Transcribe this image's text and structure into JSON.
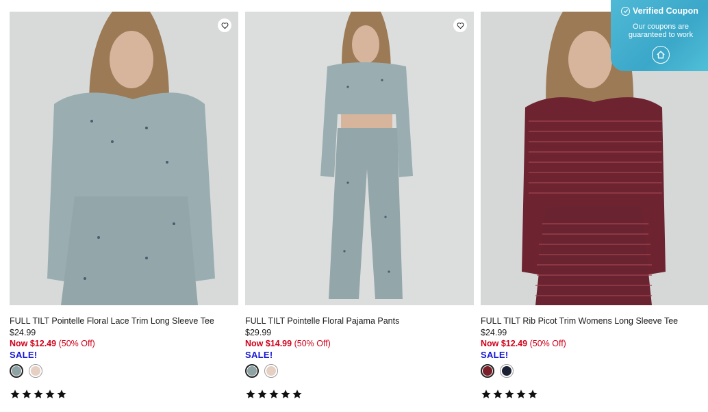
{
  "products": [
    {
      "name": "FULL TILT Pointelle Floral Lace Trim Long Sleeve Tee",
      "price": "$24.99",
      "sale_price": "Now $12.49",
      "discount": "(50% Off)",
      "sale_label": "SALE!",
      "swatches": [
        "#8fa3a5",
        "#e6cfc3"
      ],
      "rating": 5
    },
    {
      "name": "FULL TILT Pointelle Floral Pajama Pants",
      "price": "$29.99",
      "sale_price": "Now $14.99",
      "discount": "(50% Off)",
      "sale_label": "SALE!",
      "swatches": [
        "#8fa3a5",
        "#e6cfc3"
      ],
      "rating": 5
    },
    {
      "name": "FULL TILT Rib Picot Trim Womens Long Sleeve Tee",
      "price": "$24.99",
      "sale_price": "Now $12.49",
      "discount": "(50% Off)",
      "sale_label": "SALE!",
      "swatches": [
        "#7a1f2a",
        "#1c2233"
      ],
      "rating": 5
    }
  ],
  "coupon": {
    "title": "Verified Coupon",
    "message": "Our coupons are guaranteed to work"
  }
}
